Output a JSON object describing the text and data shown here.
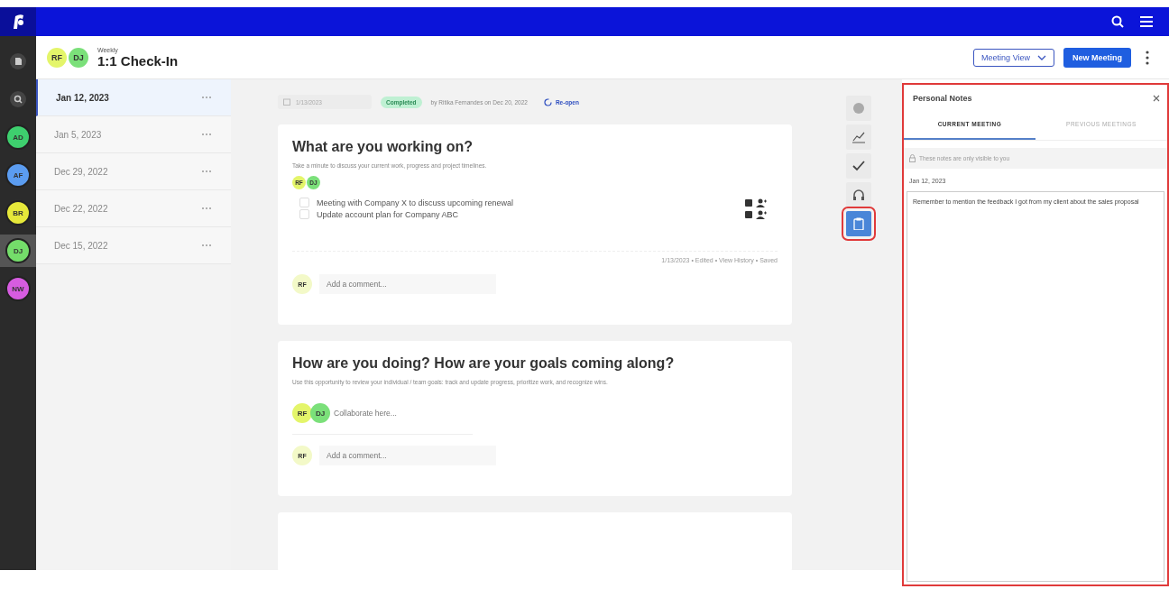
{
  "rail": {
    "avatars": [
      {
        "initials": "AD",
        "color": "#3ecf6e",
        "selected": false
      },
      {
        "initials": "AF",
        "color": "#5b9cf0",
        "selected": false
      },
      {
        "initials": "BR",
        "color": "#e6e83a",
        "selected": false
      },
      {
        "initials": "DJ",
        "color": "#74dd6a",
        "selected": true
      },
      {
        "initials": "NW",
        "color": "#d65ce0",
        "selected": false
      }
    ]
  },
  "header": {
    "participants": [
      {
        "initials": "RF",
        "color": "#e4f56a"
      },
      {
        "initials": "DJ",
        "color": "#7be07a"
      }
    ],
    "cadence": "Weekly",
    "title": "1:1 Check-In",
    "view_select": "Meeting View",
    "new_button": "New Meeting"
  },
  "meetings": [
    {
      "date": "Jan 12, 2023",
      "selected": true
    },
    {
      "date": "Jan 5, 2023",
      "selected": false
    },
    {
      "date": "Dec 29, 2022",
      "selected": false
    },
    {
      "date": "Dec 22, 2022",
      "selected": false
    },
    {
      "date": "Dec 15, 2022",
      "selected": false
    }
  ],
  "status": {
    "date_value": "1/13/2023",
    "badge": "Completed",
    "by": "by Ritika Fernandes on Dec 20, 2022",
    "reopen": "Re-open"
  },
  "cards": [
    {
      "kind": "tasks",
      "title": "What are you working on?",
      "description": "Take a minute to discuss your current work, progress and project timelines.",
      "participants": [
        {
          "initials": "RF",
          "color": "#e4f56a"
        },
        {
          "initials": "DJ",
          "color": "#7be07a"
        }
      ],
      "tasks": [
        {
          "text": "Meeting with Company X to discuss upcoming renewal",
          "checked": false
        },
        {
          "text": "Update account plan for Company ABC",
          "checked": false
        }
      ],
      "footer": "1/13/2023 • Edited • View History • Saved",
      "commenter": "RF",
      "comment_placeholder": "Add a comment..."
    },
    {
      "kind": "collab",
      "title": "How are you doing? How are your goals coming along?",
      "description": "Use this opportunity to review your individual / team goals: track and update progress, prioritize work, and recognize wins.",
      "participants": [
        {
          "initials": "RF",
          "color": "#e4f56a"
        },
        {
          "initials": "DJ",
          "color": "#7be07a"
        }
      ],
      "collab_placeholder": "Collaborate here...",
      "commenter": "RF",
      "comment_placeholder": "Add a comment..."
    },
    {
      "kind": "partial"
    }
  ],
  "tools": [
    {
      "kind": "dot",
      "selected": false
    },
    {
      "kind": "chart",
      "selected": false
    },
    {
      "kind": "check",
      "selected": false
    },
    {
      "kind": "headset",
      "selected": false
    },
    {
      "kind": "clipboard",
      "selected": true
    }
  ],
  "notes": {
    "title": "Personal Notes",
    "highlighted": true,
    "tabs": [
      {
        "label": "CURRENT MEETING",
        "selected": true
      },
      {
        "label": "PREVIOUS MEETINGS",
        "selected": false
      }
    ],
    "notice": "These notes are only visible to you",
    "date": "Jan 12, 2023",
    "text": "Remember to mention the feedback I got from my client about the sales proposal"
  }
}
